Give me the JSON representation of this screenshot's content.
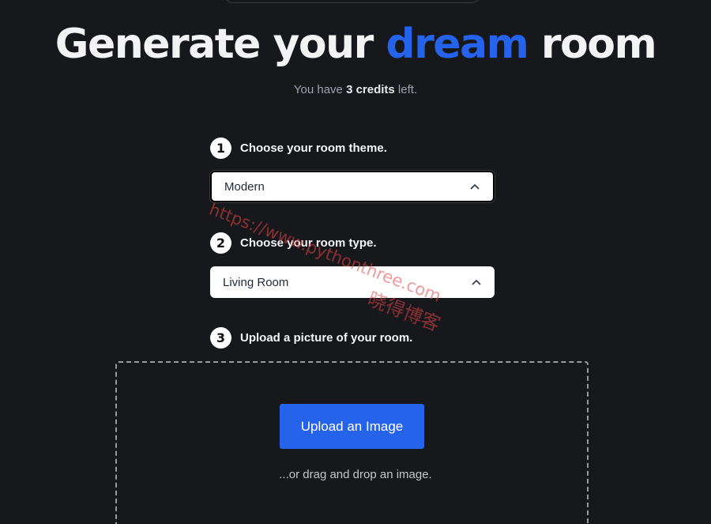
{
  "header": {
    "title_pre": "Generate your ",
    "title_accent": "dream",
    "title_post": " room",
    "credits_pre": "You have ",
    "credits_count": "3 credits",
    "credits_post": " left."
  },
  "steps": [
    {
      "number": "1",
      "label": "Choose your room theme."
    },
    {
      "number": "2",
      "label": "Choose your room type."
    },
    {
      "number": "3",
      "label": "Upload a picture of your room."
    }
  ],
  "theme_select": {
    "value": "Modern",
    "icon": "chevron-up-icon"
  },
  "type_select": {
    "value": "Living Room",
    "icon": "chevron-up-icon"
  },
  "upload": {
    "button_label": "Upload an Image",
    "hint": "...or drag and drop an image."
  },
  "watermark": {
    "url": "https://www.pythonthree.com",
    "cn": "晓得博客"
  },
  "colors": {
    "background": "#17181c",
    "accent": "#2563eb",
    "text": "#f3f3f4",
    "watermark": "#e64646"
  }
}
